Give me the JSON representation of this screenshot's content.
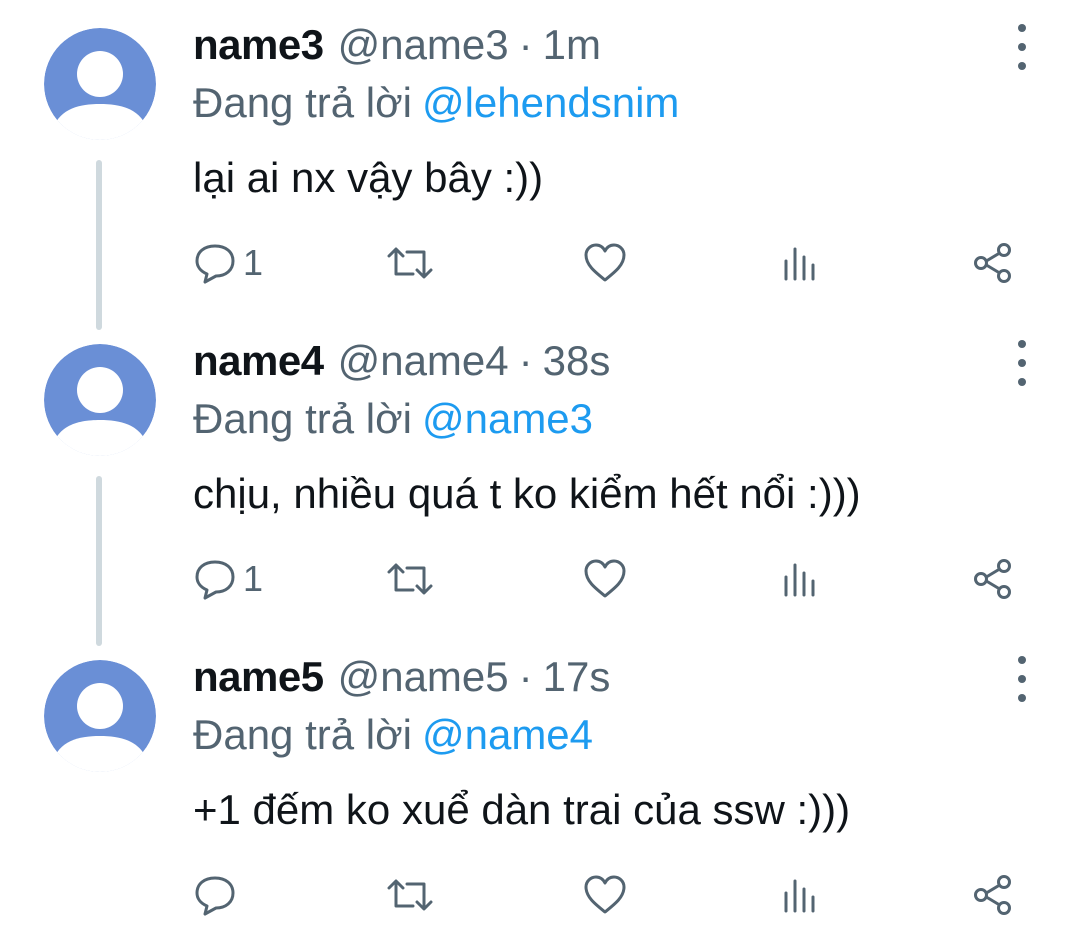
{
  "colors": {
    "text_primary": "#0f1419",
    "text_secondary": "#536471",
    "mention": "#1d9bf0",
    "avatar_background": "#6a8fd6",
    "thread_line": "#cfd9de"
  },
  "icons": {
    "reply": "reply-icon",
    "retweet": "retweet-icon",
    "like": "heart-icon",
    "views": "views-icon",
    "share": "share-icon",
    "more": "more-icon"
  },
  "tweets": [
    {
      "name": "name3",
      "handle": "@name3",
      "separator": "·",
      "time": "1m",
      "reply_prefix": "Đang trả lời",
      "reply_to": "@lehendsnim",
      "text": "lại ai nx vậy bây :))",
      "reply_count": "1"
    },
    {
      "name": "name4",
      "handle": "@name4",
      "separator": "·",
      "time": "38s",
      "reply_prefix": "Đang trả lời",
      "reply_to": "@name3",
      "text": "chịu, nhiều quá t ko kiểm hết nổi :)))",
      "reply_count": "1"
    },
    {
      "name": "name5",
      "handle": "@name5",
      "separator": "·",
      "time": "17s",
      "reply_prefix": "Đang trả lời",
      "reply_to": "@name4",
      "text": "+1 đếm ko xuể dàn trai của ssw :)))",
      "reply_count": ""
    }
  ]
}
